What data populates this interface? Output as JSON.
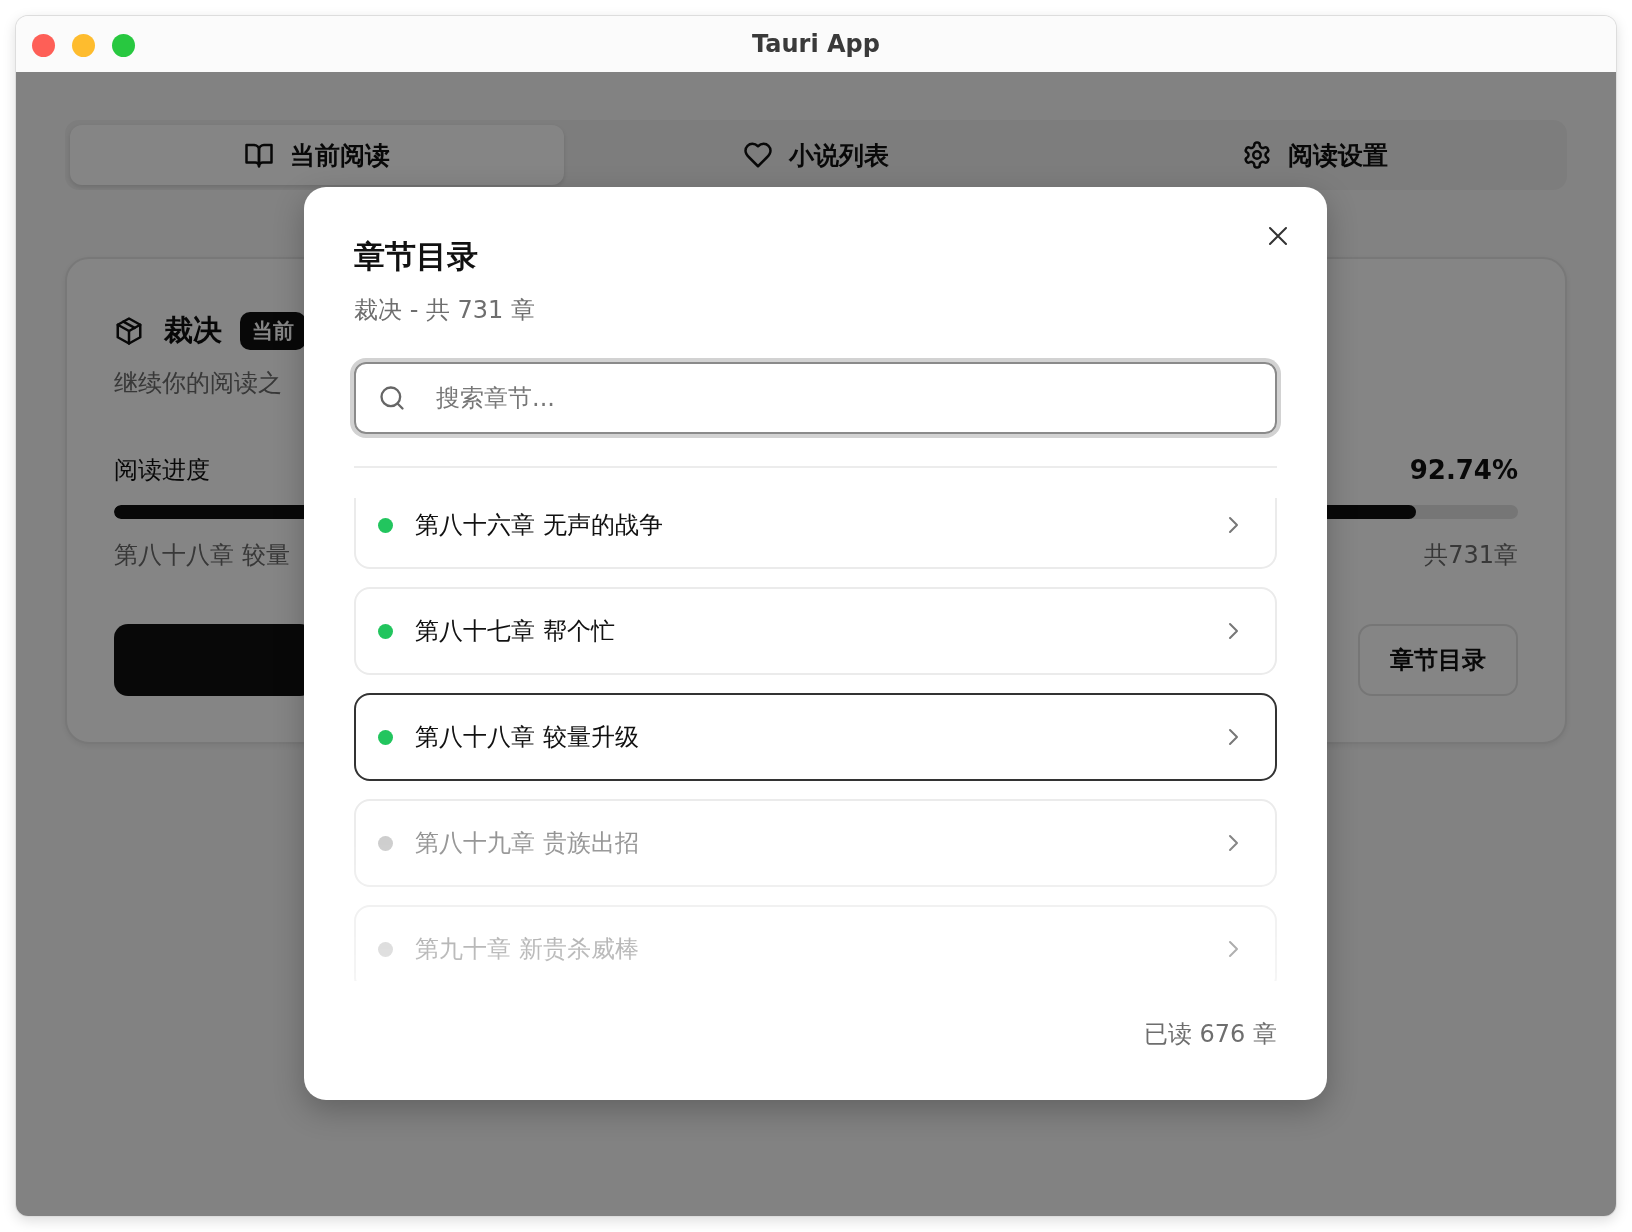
{
  "window": {
    "title": "Tauri App"
  },
  "tabs": [
    {
      "label": "当前阅读",
      "kind": "book",
      "selected": true
    },
    {
      "label": "小说列表",
      "kind": "heart",
      "selected": false
    },
    {
      "label": "阅读设置",
      "kind": "gear",
      "selected": false
    }
  ],
  "book_card": {
    "title": "裁决",
    "badge": "当前",
    "subtitle": "继续你的阅读之",
    "progress_label": "阅读进度",
    "progress_percent": "92.74%",
    "progress": {
      "level": 0.9274
    },
    "current_chapter": "第八十八章 较量",
    "total_chapters": "共731章",
    "toc_button": "章节目录"
  },
  "dialog": {
    "title": "章节目录",
    "subtitle": "裁决 - 共 731 章",
    "search": {
      "placeholder": "搜索章节..."
    },
    "chapters": [
      {
        "title": "第八十六章 无声的战争",
        "read": true,
        "selected": false
      },
      {
        "title": "第八十七章 帮个忙",
        "read": true,
        "selected": false
      },
      {
        "title": "第八十八章 较量升级",
        "read": true,
        "selected": true
      },
      {
        "title": "第八十九章 贵族出招",
        "read": false,
        "selected": false
      },
      {
        "title": "第九十章 新贵杀威棒",
        "read": false,
        "selected": false
      }
    ],
    "footer": "已读 676 章"
  }
}
